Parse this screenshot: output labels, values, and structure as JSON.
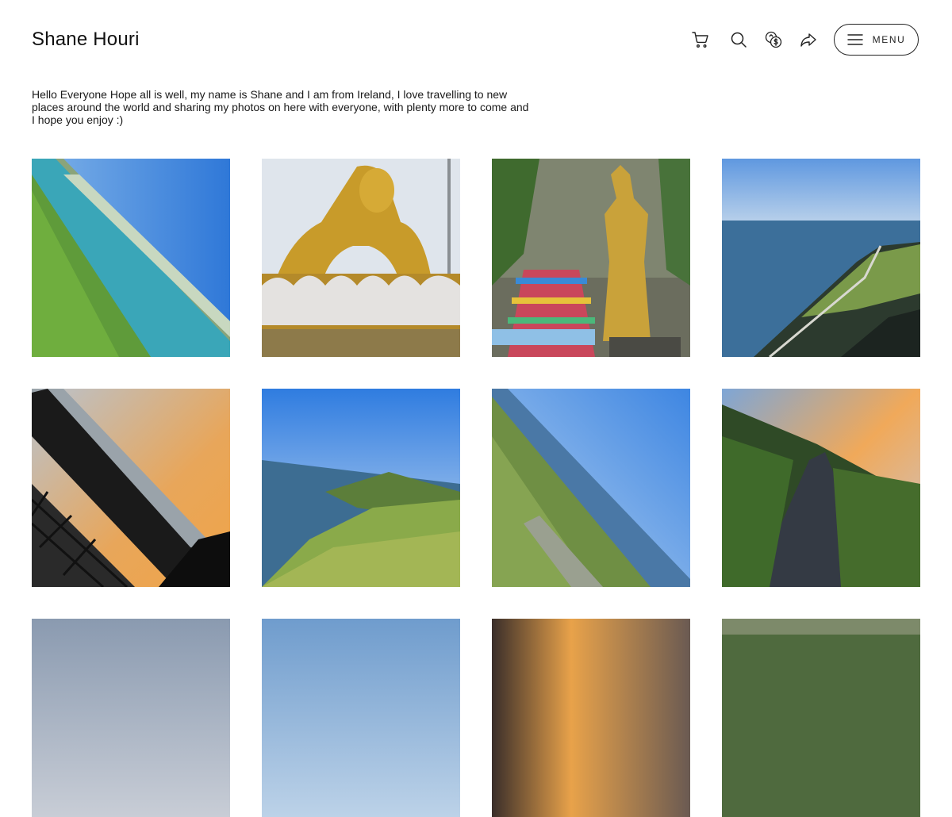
{
  "header": {
    "site_title": "Shane Houri",
    "icons": [
      "cart-icon",
      "search-icon",
      "currency-icon",
      "share-icon"
    ],
    "menu_label": "MENU"
  },
  "bio": {
    "text": "Hello Everyone Hope all is well, my name is Shane and I am from Ireland, I love travelling to new places around the world and sharing my photos on here with everyone, with plenty more to come and I hope you enjoy :)"
  },
  "gallery": {
    "photos": [
      {
        "name": "photo-coastline-tilted"
      },
      {
        "name": "photo-golden-buddha"
      },
      {
        "name": "photo-golden-statue-steps"
      },
      {
        "name": "photo-cliff-walkway"
      },
      {
        "name": "photo-sunset-railing"
      },
      {
        "name": "photo-green-headland"
      },
      {
        "name": "photo-coast-grass-tilted"
      },
      {
        "name": "photo-sunset-path"
      },
      {
        "name": "photo-row3-1"
      },
      {
        "name": "photo-row3-2"
      },
      {
        "name": "photo-row3-3"
      },
      {
        "name": "photo-row3-4"
      }
    ]
  },
  "colors": {
    "text": "#1a1a1a",
    "border": "#222222",
    "background": "#ffffff"
  }
}
